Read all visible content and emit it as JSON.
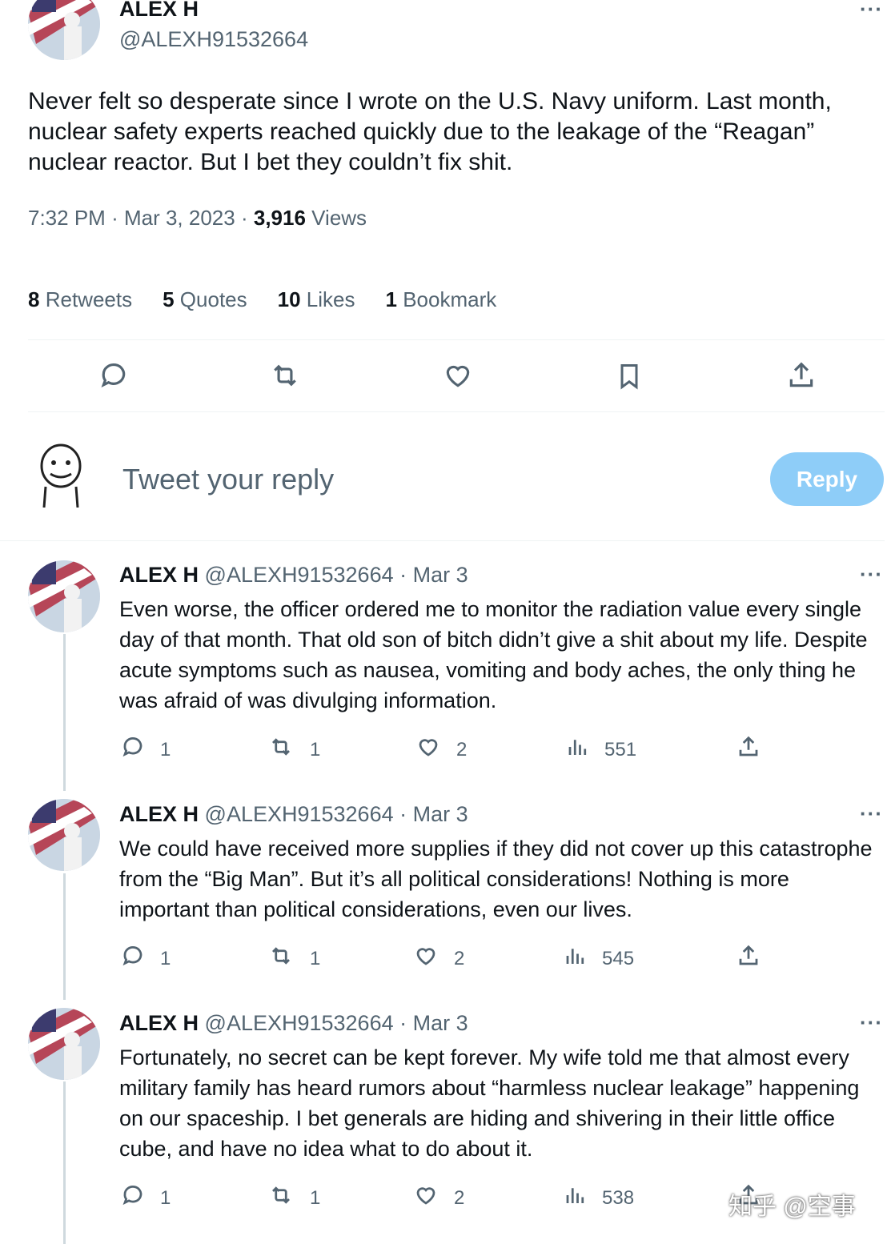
{
  "main_tweet": {
    "name": "ALEX H",
    "handle": "@ALEXH91532664",
    "more": "···",
    "text": "Never felt so desperate since I wrote on the U.S. Navy uniform. Last month, nuclear safety experts reached quickly due to the leakage of the “Reagan” nuclear reactor. But I bet they couldn’t fix shit.",
    "time": "7:32 PM",
    "date": "Mar 3, 2023",
    "views_count": "3,916",
    "views_label": "Views",
    "stats": {
      "retweets_count": "8",
      "retweets_label": "Retweets",
      "quotes_count": "5",
      "quotes_label": "Quotes",
      "likes_count": "10",
      "likes_label": "Likes",
      "bookmarks_count": "1",
      "bookmarks_label": "Bookmark"
    }
  },
  "composer": {
    "placeholder": "Tweet your reply",
    "reply_button": "Reply"
  },
  "replies": [
    {
      "name": "ALEX H",
      "handle": "@ALEXH91532664",
      "date": "Mar 3",
      "more": "···",
      "text": "Even worse, the officer ordered me to monitor the radiation value every single day of that month. That old son of bitch didn’t give a shit about my life. Despite acute symptoms such as nausea, vomiting and body aches, the only thing he was afraid of was divulging information.",
      "replies": "1",
      "retweets": "1",
      "likes": "2",
      "views": "551"
    },
    {
      "name": "ALEX H",
      "handle": "@ALEXH91532664",
      "date": "Mar 3",
      "more": "···",
      "text": "We could have received more supplies if they did not cover up this catastrophe from the “Big Man”. But it’s all political considerations! Nothing is more important than political considerations, even our lives.",
      "replies": "1",
      "retweets": "1",
      "likes": "2",
      "views": "545"
    },
    {
      "name": "ALEX H",
      "handle": "@ALEXH91532664",
      "date": "Mar 3",
      "more": "···",
      "text": "Fortunately, no secret can be kept forever. My wife told me that almost every military family has heard rumors about “harmless nuclear leakage” happening on our spaceship. I bet generals are hiding and shivering in their little office cube, and have no idea what to do about it.",
      "replies": "1",
      "retweets": "1",
      "likes": "2",
      "views": "538"
    }
  ],
  "watermark": "知乎 @空事",
  "colors": {
    "accent": "#1d9bf0",
    "reply_button_disabled": "#8ecdf8",
    "muted": "#536471"
  }
}
